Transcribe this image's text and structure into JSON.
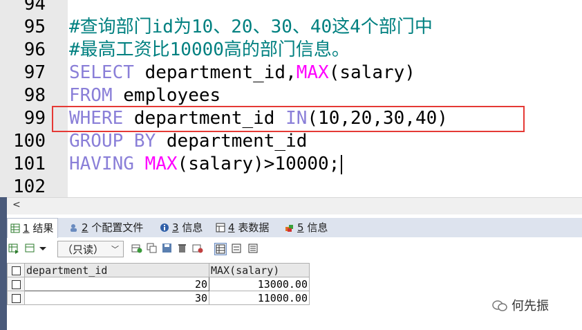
{
  "editor": {
    "lines": [
      {
        "num": "94",
        "segments": []
      },
      {
        "num": "95",
        "segments": [
          {
            "t": "#查询部门id为10、20、30、40这4个部门中",
            "c": "cmt"
          }
        ]
      },
      {
        "num": "96",
        "segments": [
          {
            "t": "#最高工资比10000高的部门信息。",
            "c": "cmt"
          }
        ]
      },
      {
        "num": "97",
        "segments": [
          {
            "t": "SELECT",
            "c": "kw"
          },
          {
            "t": " department_id,",
            "c": "id"
          },
          {
            "t": "MAX",
            "c": "fn"
          },
          {
            "t": "(salary)",
            "c": "id"
          }
        ]
      },
      {
        "num": "98",
        "segments": [
          {
            "t": "FROM",
            "c": "kw"
          },
          {
            "t": " employees",
            "c": "id"
          }
        ]
      },
      {
        "num": "99",
        "segments": [
          {
            "t": "WHERE",
            "c": "kw"
          },
          {
            "t": " department_id ",
            "c": "id"
          },
          {
            "t": "IN",
            "c": "kw"
          },
          {
            "t": "(10,20,30,40)",
            "c": "id"
          }
        ]
      },
      {
        "num": "100",
        "segments": [
          {
            "t": "GROUP BY",
            "c": "kw"
          },
          {
            "t": " department_id",
            "c": "id"
          }
        ]
      },
      {
        "num": "101",
        "segments": [
          {
            "t": "HAVING",
            "c": "kw"
          },
          {
            "t": " ",
            "c": "id"
          },
          {
            "t": "MAX",
            "c": "fn"
          },
          {
            "t": "(salary)>10000;",
            "c": "id"
          }
        ]
      },
      {
        "num": "102",
        "segments": []
      }
    ],
    "highlight_color": "#e53935"
  },
  "scroll": {
    "left_arrow": "<"
  },
  "tabs": [
    {
      "num": "1",
      "label": " 结果",
      "icon": "grid-icon",
      "active": true
    },
    {
      "num": "2",
      "label": " 个配置文件",
      "icon": "profile-icon",
      "active": false
    },
    {
      "num": "3",
      "label": " 信息",
      "icon": "info-icon",
      "active": false
    },
    {
      "num": "4",
      "label": " 表数据",
      "icon": "table-icon",
      "active": false
    },
    {
      "num": "5",
      "label": " 信息",
      "icon": "info-colored-icon",
      "active": false
    }
  ],
  "toolbar": {
    "readonly_label": "（只读）"
  },
  "results": {
    "columns": [
      "department_id",
      "MAX(salary)"
    ],
    "rows": [
      [
        "20",
        "13000.00"
      ],
      [
        "30",
        "11000.00"
      ]
    ]
  },
  "watermark": {
    "text": "何先振"
  }
}
